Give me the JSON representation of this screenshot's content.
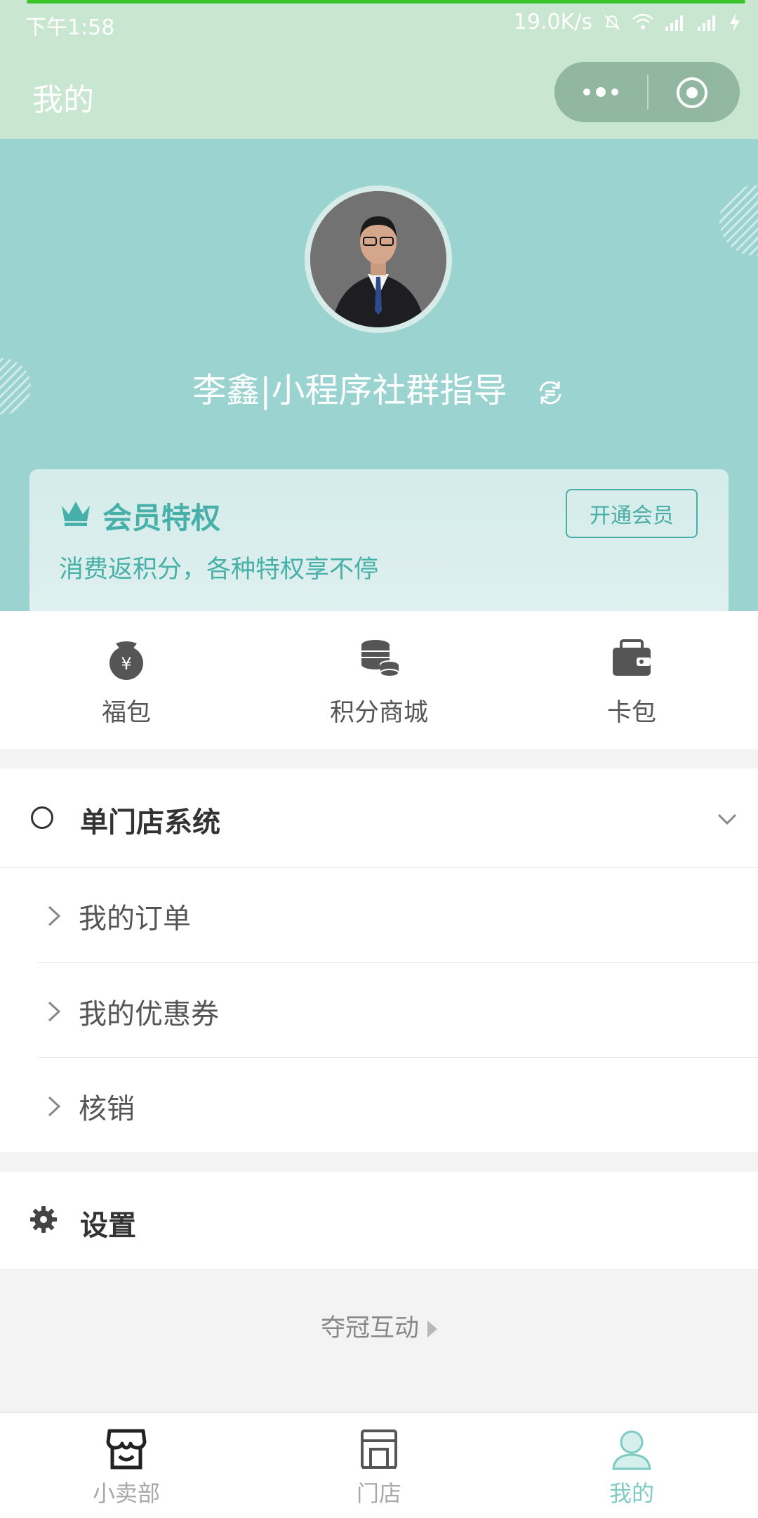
{
  "status_bar": {
    "time": "下午1:58",
    "network_speed": "19.0K/s",
    "icons": [
      "mute-bell-icon",
      "wifi-icon",
      "signal-icon",
      "signal-icon",
      "charging-icon"
    ]
  },
  "nav": {
    "title": "我的",
    "capsule_icons": [
      "more-dots-icon",
      "close-target-icon"
    ]
  },
  "profile": {
    "name": "李鑫|小程序社群指导",
    "refresh_icon": "refresh-icon"
  },
  "member": {
    "title": "会员特权",
    "description": "消费返积分，各种特权享不停",
    "button": "开通会员",
    "icon": "crown-icon"
  },
  "quick_entries": [
    {
      "label": "福包",
      "icon": "yuan-bag-icon"
    },
    {
      "label": "积分商城",
      "icon": "coins-icon"
    },
    {
      "label": "卡包",
      "icon": "wallet-icon"
    }
  ],
  "system": {
    "title": "单门店系统",
    "items": [
      {
        "label": "我的订单"
      },
      {
        "label": "我的优惠券"
      },
      {
        "label": "核销"
      }
    ]
  },
  "settings": {
    "label": "设置"
  },
  "brand": {
    "label": "夺冠互动"
  },
  "tabs": [
    {
      "label": "小卖部",
      "icon": "shop-icon",
      "active": false
    },
    {
      "label": "门店",
      "icon": "store-icon",
      "active": false
    },
    {
      "label": "我的",
      "icon": "user-icon",
      "active": true
    }
  ],
  "colors": {
    "header_bg": "#9bd3d0",
    "nav_bg": "#c9e6d0",
    "accent": "#47b0a8",
    "active_tab": "#7ecbc4"
  }
}
